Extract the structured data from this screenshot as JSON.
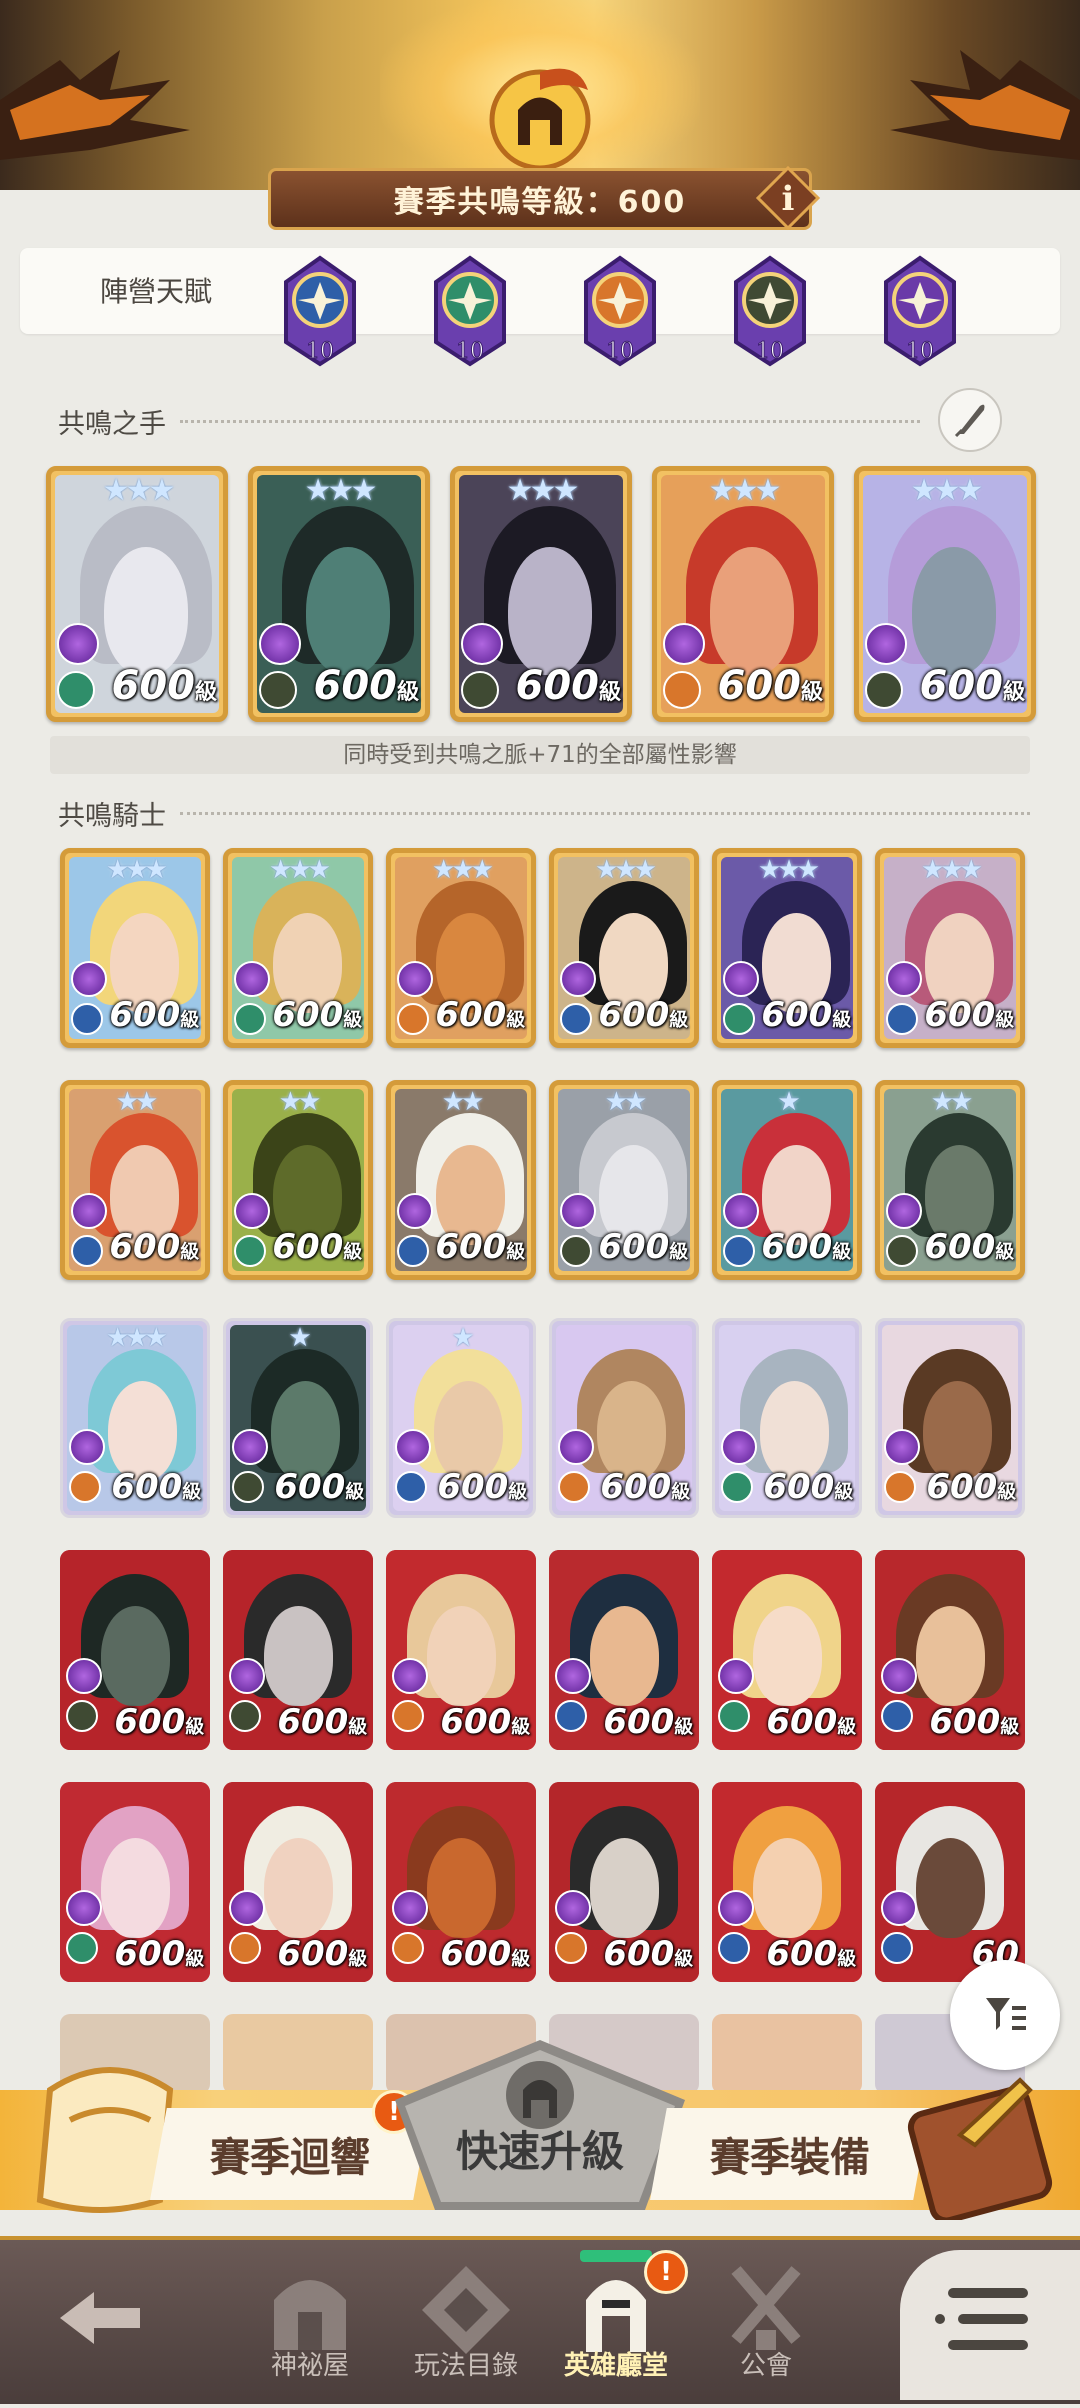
{
  "header": {
    "title": "賽季共鳴等級：600",
    "info_icon": "info-icon"
  },
  "faction_talent": {
    "label": "陣營天賦",
    "badges": [
      {
        "level": "10",
        "color": "#2e5fa8"
      },
      {
        "level": "10",
        "color": "#2f8e6a"
      },
      {
        "level": "10",
        "color": "#d8762b"
      },
      {
        "level": "10",
        "color": "#3f4a33"
      },
      {
        "level": "10",
        "color": "#6a3aa8"
      }
    ]
  },
  "resonance_hands": {
    "title": "共鳴之手",
    "note": "同時受到共鳴之脈+71的全部屬性影響",
    "heroes": [
      {
        "level": "600",
        "unit": "級",
        "stars": "★★★",
        "bg": "#cfd5dc",
        "skin": "#e8e8ee",
        "hair": "#b9bcc6",
        "class_color": "#2f8e6a"
      },
      {
        "level": "600",
        "unit": "級",
        "stars": "★★★",
        "bg": "#3a5f56",
        "skin": "#4f7f76",
        "hair": "#1e2a28",
        "class_color": "#3f4a33"
      },
      {
        "level": "600",
        "unit": "級",
        "stars": "★★★",
        "bg": "#4b4458",
        "skin": "#b9b3c8",
        "hair": "#1c1a24",
        "class_color": "#3f4a33"
      },
      {
        "level": "600",
        "unit": "級",
        "stars": "★★★",
        "bg": "#e6a05a",
        "skin": "#e9a07a",
        "hair": "#c73a2a",
        "class_color": "#d8762b"
      },
      {
        "level": "600",
        "unit": "級",
        "stars": "★★★",
        "bg": "#b7b3e6",
        "skin": "#8a9aa8",
        "hair": "#b59cd9",
        "class_color": "#3f4a33"
      }
    ]
  },
  "resonance_knights": {
    "title": "共鳴騎士",
    "rows": [
      [
        {
          "level": "600",
          "unit": "級",
          "stars": "★★★",
          "frame": "gold",
          "bg": "#9cc7e8",
          "skin": "#f4d6c0",
          "hair": "#f2d67a",
          "class_color": "#2e5fa8"
        },
        {
          "level": "600",
          "unit": "級",
          "stars": "★★★",
          "frame": "gold",
          "bg": "#8fc8a8",
          "skin": "#f0d2b4",
          "hair": "#d9b35a",
          "class_color": "#2f8e6a"
        },
        {
          "level": "600",
          "unit": "級",
          "stars": "★★★",
          "frame": "gold",
          "bg": "#e0a060",
          "skin": "#d9873f",
          "hair": "#b5652a",
          "class_color": "#d8762b"
        },
        {
          "level": "600",
          "unit": "級",
          "stars": "★★★",
          "frame": "gold",
          "bg": "#cdb48a",
          "skin": "#f0d8c2",
          "hair": "#1a1a1a",
          "class_color": "#2e5fa8"
        },
        {
          "level": "600",
          "unit": "級",
          "stars": "★★★",
          "frame": "gold",
          "bg": "#6b5aa8",
          "skin": "#f1dcd2",
          "hair": "#2b2455",
          "class_color": "#2f8e6a"
        },
        {
          "level": "600",
          "unit": "級",
          "stars": "★★★",
          "frame": "gold",
          "bg": "#c6b0c8",
          "skin": "#f0d2c0",
          "hair": "#b85a7a",
          "class_color": "#2e5fa8"
        }
      ],
      [
        {
          "level": "600",
          "unit": "級",
          "stars": "★★",
          "frame": "gold",
          "bg": "#d9a070",
          "skin": "#f0c9b0",
          "hair": "#d9532e",
          "class_color": "#2e5fa8"
        },
        {
          "level": "600",
          "unit": "級",
          "stars": "★★",
          "frame": "gold",
          "bg": "#9ab04a",
          "skin": "#5e6b2a",
          "hair": "#3b4418",
          "class_color": "#2f8e6a"
        },
        {
          "level": "600",
          "unit": "級",
          "stars": "★★",
          "frame": "gold",
          "bg": "#8a7a6a",
          "skin": "#e8b890",
          "hair": "#f0efe8",
          "class_color": "#2e5fa8"
        },
        {
          "level": "600",
          "unit": "級",
          "stars": "★★",
          "frame": "gold",
          "bg": "#9aa0a8",
          "skin": "#e6e6ea",
          "hair": "#c7c9cf",
          "class_color": "#3f4a33"
        },
        {
          "level": "600",
          "unit": "級",
          "stars": "★",
          "frame": "gold",
          "bg": "#5a9aa0",
          "skin": "#f1d4c8",
          "hair": "#c9303a",
          "class_color": "#2e5fa8"
        },
        {
          "level": "600",
          "unit": "級",
          "stars": "★★",
          "frame": "gold",
          "bg": "#8aa090",
          "skin": "#6a7a6a",
          "hair": "#2a3a30",
          "class_color": "#3f4a33"
        }
      ],
      [
        {
          "level": "600",
          "unit": "級",
          "stars": "★★★",
          "frame": "silver",
          "bg": "#b8c8e8",
          "skin": "#f4dfd6",
          "hair": "#7ec9d6",
          "class_color": "#d8762b"
        },
        {
          "level": "600",
          "unit": "級",
          "stars": "★",
          "frame": "silver",
          "bg": "#3a5050",
          "skin": "#5c7a6a",
          "hair": "#1c2a26",
          "class_color": "#3f4a33"
        },
        {
          "level": "600",
          "unit": "級",
          "stars": "★",
          "frame": "silver",
          "bg": "#dcd0f0",
          "skin": "#e9c9a8",
          "hair": "#f2df9a",
          "class_color": "#2e5fa8"
        },
        {
          "level": "600",
          "unit": "級",
          "stars": "",
          "frame": "silver",
          "bg": "#d8c8f0",
          "skin": "#d9b48a",
          "hair": "#b08660",
          "class_color": "#d8762b"
        },
        {
          "level": "600",
          "unit": "級",
          "stars": "",
          "frame": "silver",
          "bg": "#d8d0f0",
          "skin": "#f0e0d6",
          "hair": "#a8b4c0",
          "class_color": "#2f8e6a"
        },
        {
          "level": "600",
          "unit": "級",
          "stars": "",
          "frame": "silver",
          "bg": "#e8d8e0",
          "skin": "#9a6a4a",
          "hair": "#5a3a24",
          "class_color": "#d8762b"
        }
      ],
      [
        {
          "level": "600",
          "unit": "級",
          "stars": "",
          "frame": "red",
          "bg": "#b6242a",
          "skin": "#5a6a60",
          "hair": "#1e2824",
          "class_color": "#3f4a33"
        },
        {
          "level": "600",
          "unit": "級",
          "stars": "",
          "frame": "red",
          "bg": "#b6242a",
          "skin": "#c9c2c2",
          "hair": "#2a2a2a",
          "class_color": "#3f4a33"
        },
        {
          "level": "600",
          "unit": "級",
          "stars": "",
          "frame": "red",
          "bg": "#c22a2e",
          "skin": "#f1d2b8",
          "hair": "#e8c89a",
          "class_color": "#d8762b"
        },
        {
          "level": "600",
          "unit": "級",
          "stars": "",
          "frame": "red",
          "bg": "#b92a2e",
          "skin": "#e8b890",
          "hair": "#1e2e40",
          "class_color": "#2e5fa8"
        },
        {
          "level": "600",
          "unit": "級",
          "stars": "",
          "frame": "red",
          "bg": "#c3292e",
          "skin": "#f6dcc8",
          "hair": "#f0d48a",
          "class_color": "#2f8e6a"
        },
        {
          "level": "600",
          "unit": "級",
          "stars": "",
          "frame": "red",
          "bg": "#b8282c",
          "skin": "#e8c09a",
          "hair": "#6a3a24",
          "class_color": "#2e5fa8"
        }
      ],
      [
        {
          "level": "600",
          "unit": "級",
          "stars": "",
          "frame": "red",
          "bg": "#c02a32",
          "skin": "#f4dbe0",
          "hair": "#e2a2c4",
          "class_color": "#2f8e6a"
        },
        {
          "level": "600",
          "unit": "級",
          "stars": "",
          "frame": "red",
          "bg": "#b8262c",
          "skin": "#f0d2c0",
          "hair": "#f0ede2",
          "class_color": "#d8762b"
        },
        {
          "level": "600",
          "unit": "級",
          "stars": "",
          "frame": "red",
          "bg": "#bd2a2e",
          "skin": "#c9682e",
          "hair": "#8a3a1e",
          "class_color": "#d8762b"
        },
        {
          "level": "600",
          "unit": "級",
          "stars": "",
          "frame": "red",
          "bg": "#b4262a",
          "skin": "#d8d0c8",
          "hair": "#2a2a2a",
          "class_color": "#d8762b"
        },
        {
          "level": "600",
          "unit": "級",
          "stars": "",
          "frame": "red",
          "bg": "#c2292e",
          "skin": "#f4d0b0",
          "hair": "#f0a040",
          "class_color": "#2e5fa8"
        },
        {
          "level": "60",
          "unit": "",
          "stars": "",
          "frame": "red",
          "bg": "#b6262a",
          "skin": "#6a4a3a",
          "hair": "#e8e6e2",
          "class_color": "#2e5fa8"
        }
      ]
    ]
  },
  "actions": {
    "season_echo": "賽季迴響",
    "quick_level": "快速升級",
    "season_gear": "賽季裝備",
    "alert_mark": "!"
  },
  "nav": {
    "items": [
      {
        "label": "",
        "icon": "back-arrow-icon"
      },
      {
        "label": "神祕屋",
        "icon": "mystery-house-icon"
      },
      {
        "label": "玩法目錄",
        "icon": "game-catalog-icon"
      },
      {
        "label": "英雄廳堂",
        "icon": "hero-hall-icon",
        "active": true
      },
      {
        "label": "公會",
        "icon": "guild-icon"
      }
    ],
    "menu_icon": "menu-icon",
    "filter_icon": "filter-icon"
  }
}
